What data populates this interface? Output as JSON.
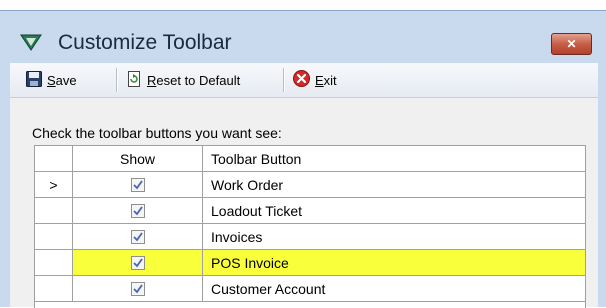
{
  "window": {
    "title": "Customize Toolbar",
    "close_glyph": "✕"
  },
  "toolbar": {
    "save_label": "Save",
    "reset_label": "Reset to Default",
    "exit_label": "Exit"
  },
  "instructions": "Check the toolbar buttons you want see:",
  "grid": {
    "columns": [
      "",
      "Show",
      "Toolbar Button"
    ],
    "rows": [
      {
        "indicator": ">",
        "show": true,
        "label": "Work Order",
        "highlighted": false
      },
      {
        "indicator": "",
        "show": true,
        "label": "Loadout Ticket",
        "highlighted": false
      },
      {
        "indicator": "",
        "show": true,
        "label": "Invoices",
        "highlighted": false
      },
      {
        "indicator": "",
        "show": true,
        "label": "POS Invoice",
        "highlighted": true
      },
      {
        "indicator": "",
        "show": true,
        "label": "Customer Account",
        "highlighted": false
      }
    ]
  },
  "colors": {
    "highlight": "#faff3c",
    "checkmark": "#4a64b0"
  },
  "icons": {
    "app": "triangle-logo-icon",
    "save": "floppy-disk-icon",
    "reset": "reset-document-icon",
    "exit": "red-x-circle-icon"
  }
}
